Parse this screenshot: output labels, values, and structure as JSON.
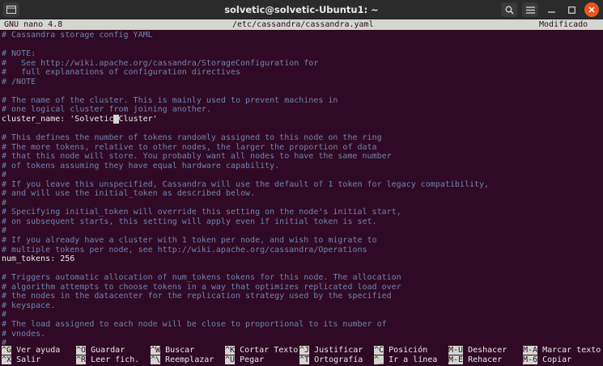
{
  "window": {
    "title": "solvetic@solvetic-Ubuntu1: ~",
    "newtab_icon": "terminal-tab-icon",
    "search_icon": "search-icon",
    "menu_icon": "hamburger-menu-icon",
    "minimize_icon": "minimize-icon",
    "maximize_icon": "maximize-icon",
    "close_icon": "close-icon"
  },
  "nano": {
    "version": "GNU nano 4.8",
    "file": "/etc/cassandra/cassandra.yaml",
    "status": "Modificado"
  },
  "editor": {
    "lines": [
      {
        "type": "comment",
        "text": "# Cassandra storage config YAML"
      },
      {
        "type": "blank",
        "text": ""
      },
      {
        "type": "comment",
        "text": "# NOTE:"
      },
      {
        "type": "comment",
        "text": "#   See http://wiki.apache.org/cassandra/StorageConfiguration for"
      },
      {
        "type": "comment",
        "text": "#   full explanations of configuration directives"
      },
      {
        "type": "comment",
        "text": "# /NOTE"
      },
      {
        "type": "blank",
        "text": ""
      },
      {
        "type": "comment",
        "text": "# The name of the cluster. This is mainly used to prevent machines in"
      },
      {
        "type": "comment",
        "text": "# one logical cluster from joining another."
      },
      {
        "type": "cursor",
        "before": "cluster_name: 'Solvetic",
        "cursor": " ",
        "after": "Cluster'"
      },
      {
        "type": "blank",
        "text": ""
      },
      {
        "type": "comment",
        "text": "# This defines the number of tokens randomly assigned to this node on the ring"
      },
      {
        "type": "comment",
        "text": "# The more tokens, relative to other nodes, the larger the proportion of data"
      },
      {
        "type": "comment",
        "text": "# that this node will store. You probably want all nodes to have the same number"
      },
      {
        "type": "comment",
        "text": "# of tokens assuming they have equal hardware capability."
      },
      {
        "type": "comment",
        "text": "#"
      },
      {
        "type": "comment",
        "text": "# If you leave this unspecified, Cassandra will use the default of 1 token for legacy compatibility,"
      },
      {
        "type": "comment",
        "text": "# and will use the initial_token as described below."
      },
      {
        "type": "comment",
        "text": "#"
      },
      {
        "type": "comment",
        "text": "# Specifying initial_token will override this setting on the node's initial start,"
      },
      {
        "type": "comment",
        "text": "# on subsequent starts, this setting will apply even if initial token is set."
      },
      {
        "type": "comment",
        "text": "#"
      },
      {
        "type": "comment",
        "text": "# If you already have a cluster with 1 token per node, and wish to migrate to"
      },
      {
        "type": "comment",
        "text": "# multiple tokens per node, see http://wiki.apache.org/cassandra/Operations"
      },
      {
        "type": "code",
        "text": "num_tokens: 256"
      },
      {
        "type": "blank",
        "text": ""
      },
      {
        "type": "comment",
        "text": "# Triggers automatic allocation of num_tokens tokens for this node. The allocation"
      },
      {
        "type": "comment",
        "text": "# algorithm attempts to choose tokens in a way that optimizes replicated load over"
      },
      {
        "type": "comment",
        "text": "# the nodes in the datacenter for the replication strategy used by the specified"
      },
      {
        "type": "comment",
        "text": "# keyspace."
      },
      {
        "type": "comment",
        "text": "#"
      },
      {
        "type": "comment",
        "text": "# The load assigned to each node will be close to proportional to its number of"
      },
      {
        "type": "comment",
        "text": "# vnodes."
      },
      {
        "type": "comment",
        "text": "#"
      }
    ]
  },
  "shortcuts": [
    {
      "key": "^G",
      "label": "Ver ayuda"
    },
    {
      "key": "^O",
      "label": "Guardar"
    },
    {
      "key": "^W",
      "label": "Buscar"
    },
    {
      "key": "^K",
      "label": "Cortar Texto"
    },
    {
      "key": "^J",
      "label": "Justificar"
    },
    {
      "key": "^C",
      "label": "Posición"
    },
    {
      "key": "M-U",
      "label": "Deshacer"
    },
    {
      "key": "M-A",
      "label": "Marcar texto"
    },
    {
      "key": "^X",
      "label": "Salir"
    },
    {
      "key": "^R",
      "label": "Leer fich."
    },
    {
      "key": "^\\",
      "label": "Reemplazar"
    },
    {
      "key": "^U",
      "label": "Pegar"
    },
    {
      "key": "^T",
      "label": "Ortografía"
    },
    {
      "key": "^_",
      "label": "Ir a línea"
    },
    {
      "key": "M-E",
      "label": "Rehacer"
    },
    {
      "key": "M-6",
      "label": "Copiar"
    }
  ]
}
